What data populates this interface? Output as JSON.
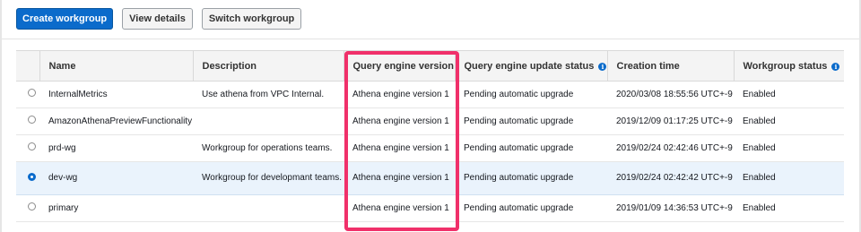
{
  "toolbar": {
    "create_label": "Create workgroup",
    "view_label": "View details",
    "switch_label": "Switch workgroup"
  },
  "table": {
    "headers": {
      "name": "Name",
      "description": "Description",
      "engine": "Query engine version",
      "update_status": "Query engine update status",
      "creation_time": "Creation time",
      "workgroup_status": "Workgroup status"
    },
    "info_glyph": "i",
    "rows": [
      {
        "selected": false,
        "name": "InternalMetrics",
        "description": "Use athena from VPC Internal.",
        "engine": "Athena engine version 1",
        "update_status": "Pending automatic upgrade",
        "creation_time": "2020/03/08 18:55:56 UTC+-9",
        "status": "Enabled"
      },
      {
        "selected": false,
        "name": "AmazonAthenaPreviewFunctionality",
        "description": "",
        "engine": "Athena engine version 1",
        "update_status": "Pending automatic upgrade",
        "creation_time": "2019/12/09 01:17:25 UTC+-9",
        "status": "Enabled"
      },
      {
        "selected": false,
        "name": "prd-wg",
        "description": "Workgroup for operations teams.",
        "engine": "Athena engine version 1",
        "update_status": "Pending automatic upgrade",
        "creation_time": "2019/02/24 02:42:46 UTC+-9",
        "status": "Enabled"
      },
      {
        "selected": true,
        "name": "dev-wg",
        "description": "Workgroup for developmant teams.",
        "engine": "Athena engine version 1",
        "update_status": "Pending automatic upgrade",
        "creation_time": "2019/02/24 02:42:42 UTC+-9",
        "status": "Enabled"
      },
      {
        "selected": false,
        "name": "primary",
        "description": "",
        "engine": "Athena engine version 1",
        "update_status": "Pending automatic upgrade",
        "creation_time": "2019/01/09 14:36:53 UTC+-9",
        "status": "Enabled"
      }
    ]
  },
  "colors": {
    "primary_button": "#0b6bcb",
    "enabled_status": "#1d8102",
    "highlight_box": "#f0306a",
    "selected_row": "#eaf3fc"
  }
}
